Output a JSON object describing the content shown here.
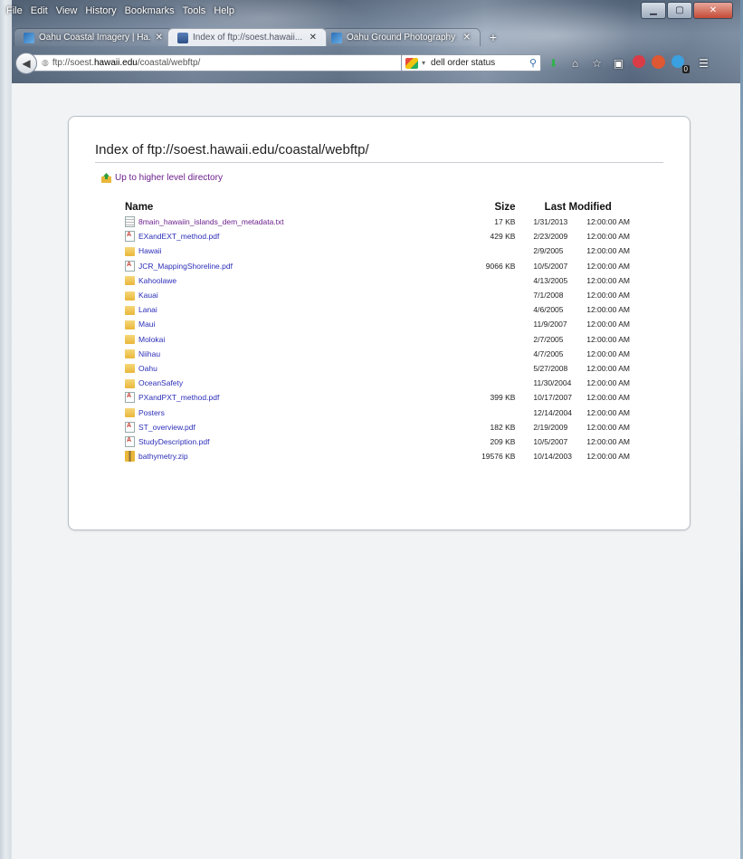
{
  "menubar": [
    "File",
    "Edit",
    "View",
    "History",
    "Bookmarks",
    "Tools",
    "Help"
  ],
  "tabs": [
    {
      "label": "Oahu Coastal Imagery | Ha...",
      "active": false
    },
    {
      "label": "Index of ftp://soest.hawaii...",
      "active": true
    },
    {
      "label": "Oahu Ground Photography ...",
      "active": false
    }
  ],
  "nav": {
    "url_prefix": "ftp://soest.",
    "url_host": "hawaii.edu",
    "url_path": "/coastal/webftp/",
    "search_value": "dell order status",
    "badge_count": "0"
  },
  "page": {
    "title": "Index of ftp://soest.hawaii.edu/coastal/webftp/",
    "up_link": "Up to higher level directory",
    "headers": {
      "name": "Name",
      "size": "Size",
      "modified": "Last Modified"
    }
  },
  "files": [
    {
      "name": "8main_hawaiin_islands_dem_metadata.txt",
      "type": "txt",
      "size": "17 KB",
      "date": "1/31/2013",
      "time": "12:00:00 AM",
      "visited": true
    },
    {
      "name": "EXandEXT_method.pdf",
      "type": "pdf",
      "size": "429 KB",
      "date": "2/23/2009",
      "time": "12:00:00 AM",
      "visited": false
    },
    {
      "name": "Hawaii",
      "type": "folder",
      "size": "",
      "date": "2/9/2005",
      "time": "12:00:00 AM",
      "visited": false
    },
    {
      "name": "JCR_MappingShoreline.pdf",
      "type": "pdf",
      "size": "9066 KB",
      "date": "10/5/2007",
      "time": "12:00:00 AM",
      "visited": false
    },
    {
      "name": "Kahoolawe",
      "type": "folder",
      "size": "",
      "date": "4/13/2005",
      "time": "12:00:00 AM",
      "visited": false
    },
    {
      "name": "Kauai",
      "type": "folder",
      "size": "",
      "date": "7/1/2008",
      "time": "12:00:00 AM",
      "visited": false
    },
    {
      "name": "Lanai",
      "type": "folder",
      "size": "",
      "date": "4/6/2005",
      "time": "12:00:00 AM",
      "visited": false
    },
    {
      "name": "Maui",
      "type": "folder",
      "size": "",
      "date": "11/9/2007",
      "time": "12:00:00 AM",
      "visited": false
    },
    {
      "name": "Molokai",
      "type": "folder",
      "size": "",
      "date": "2/7/2005",
      "time": "12:00:00 AM",
      "visited": false
    },
    {
      "name": "Niihau",
      "type": "folder",
      "size": "",
      "date": "4/7/2005",
      "time": "12:00:00 AM",
      "visited": false
    },
    {
      "name": "Oahu",
      "type": "folder",
      "size": "",
      "date": "5/27/2008",
      "time": "12:00:00 AM",
      "visited": false
    },
    {
      "name": "OceanSafety",
      "type": "folder",
      "size": "",
      "date": "11/30/2004",
      "time": "12:00:00 AM",
      "visited": false
    },
    {
      "name": "PXandPXT_method.pdf",
      "type": "pdf",
      "size": "399 KB",
      "date": "10/17/2007",
      "time": "12:00:00 AM",
      "visited": false
    },
    {
      "name": "Posters",
      "type": "folder",
      "size": "",
      "date": "12/14/2004",
      "time": "12:00:00 AM",
      "visited": false
    },
    {
      "name": "ST_overview.pdf",
      "type": "pdf",
      "size": "182 KB",
      "date": "2/19/2009",
      "time": "12:00:00 AM",
      "visited": false
    },
    {
      "name": "StudyDescription.pdf",
      "type": "pdf",
      "size": "209 KB",
      "date": "10/5/2007",
      "time": "12:00:00 AM",
      "visited": false
    },
    {
      "name": "bathymetry.zip",
      "type": "zip",
      "size": "19576 KB",
      "date": "10/14/2003",
      "time": "12:00:00 AM",
      "visited": false
    }
  ]
}
